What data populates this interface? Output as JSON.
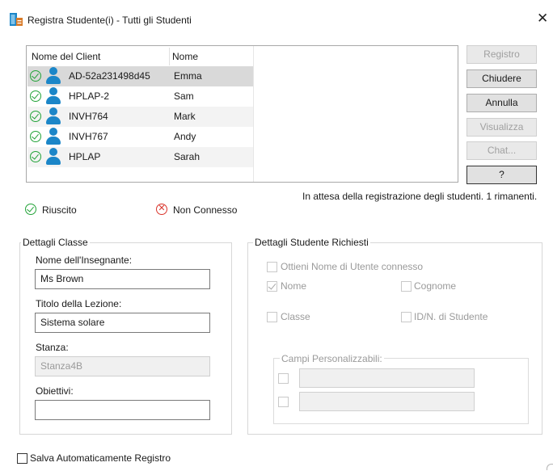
{
  "window": {
    "title": "Registra Studente(i) - Tutti gli Studenti"
  },
  "list": {
    "columns": [
      "Nome del Client",
      "Nome"
    ],
    "rows": [
      {
        "client": "AD-52a231498d45",
        "name": "Emma"
      },
      {
        "client": "HPLAP-2",
        "name": "Sam"
      },
      {
        "client": "INVH764",
        "name": "Mark"
      },
      {
        "client": "INVH767",
        "name": "Andy"
      },
      {
        "client": "HPLAP",
        "name": "Sarah"
      }
    ]
  },
  "buttons": {
    "register": "Registro",
    "close": "Chiudere",
    "cancel": "Annulla",
    "view": "Visualizza",
    "chat": "Chat...",
    "help": "?"
  },
  "status": {
    "message": "In attesa della registrazione degli studenti. 1 rimanenti."
  },
  "legend": {
    "success": "Riuscito",
    "not_connected": "Non Connesso"
  },
  "class_details": {
    "group_label": "Dettagli Classe",
    "teacher_label": "Nome dell'Insegnante:",
    "teacher_value": "Ms Brown",
    "lesson_label": "Titolo della Lezione:",
    "lesson_value": "Sistema solare",
    "room_label": "Stanza:",
    "room_value": "Stanza4B",
    "objectives_label": "Obiettivi:",
    "objectives_value": ""
  },
  "student_details": {
    "group_label": "Dettagli Studente Richiesti",
    "logged_user": "Ottieni Nome di Utente connesso",
    "first_name": "Nome",
    "last_name": "Cognome",
    "class": "Classe",
    "student_id": "ID/N. di Studente",
    "custom_label": "Campi Personalizzabili:"
  },
  "footer": {
    "autosave": "Salva Automaticamente Registro"
  },
  "colors": {
    "success_green": "#22a338",
    "fail_red": "#d9342b",
    "person_blue": "#1b86c8",
    "selected_row": "#d9d9d9"
  },
  "icons": {
    "app": "register-app-icon",
    "close": "close-icon",
    "connected": "check-circle-icon",
    "student": "person-icon",
    "not_connected": "x-circle-icon"
  }
}
